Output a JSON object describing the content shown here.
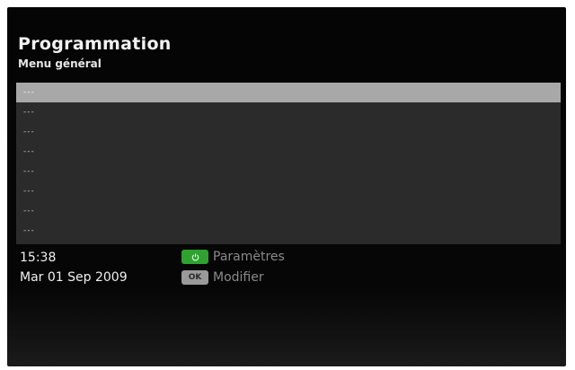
{
  "header": {
    "title": "Programmation",
    "subtitle": "Menu général"
  },
  "list": {
    "selected_index": 0,
    "items": [
      {
        "label": "---"
      },
      {
        "label": "---"
      },
      {
        "label": "---"
      },
      {
        "label": "---"
      },
      {
        "label": "---"
      },
      {
        "label": "---"
      },
      {
        "label": "---"
      },
      {
        "label": "---"
      }
    ]
  },
  "status": {
    "time": "15:38",
    "date": "Mar 01 Sep 2009"
  },
  "legend": {
    "green_button": {
      "icon": "power-icon",
      "color": "#2fa12f",
      "label": "Paramètres"
    },
    "ok_button": {
      "key_label": "OK",
      "label": "Modifier"
    }
  },
  "colors": {
    "background": "#050505",
    "list_background": "#2b2b2b",
    "selection": "#a8a8a8"
  }
}
